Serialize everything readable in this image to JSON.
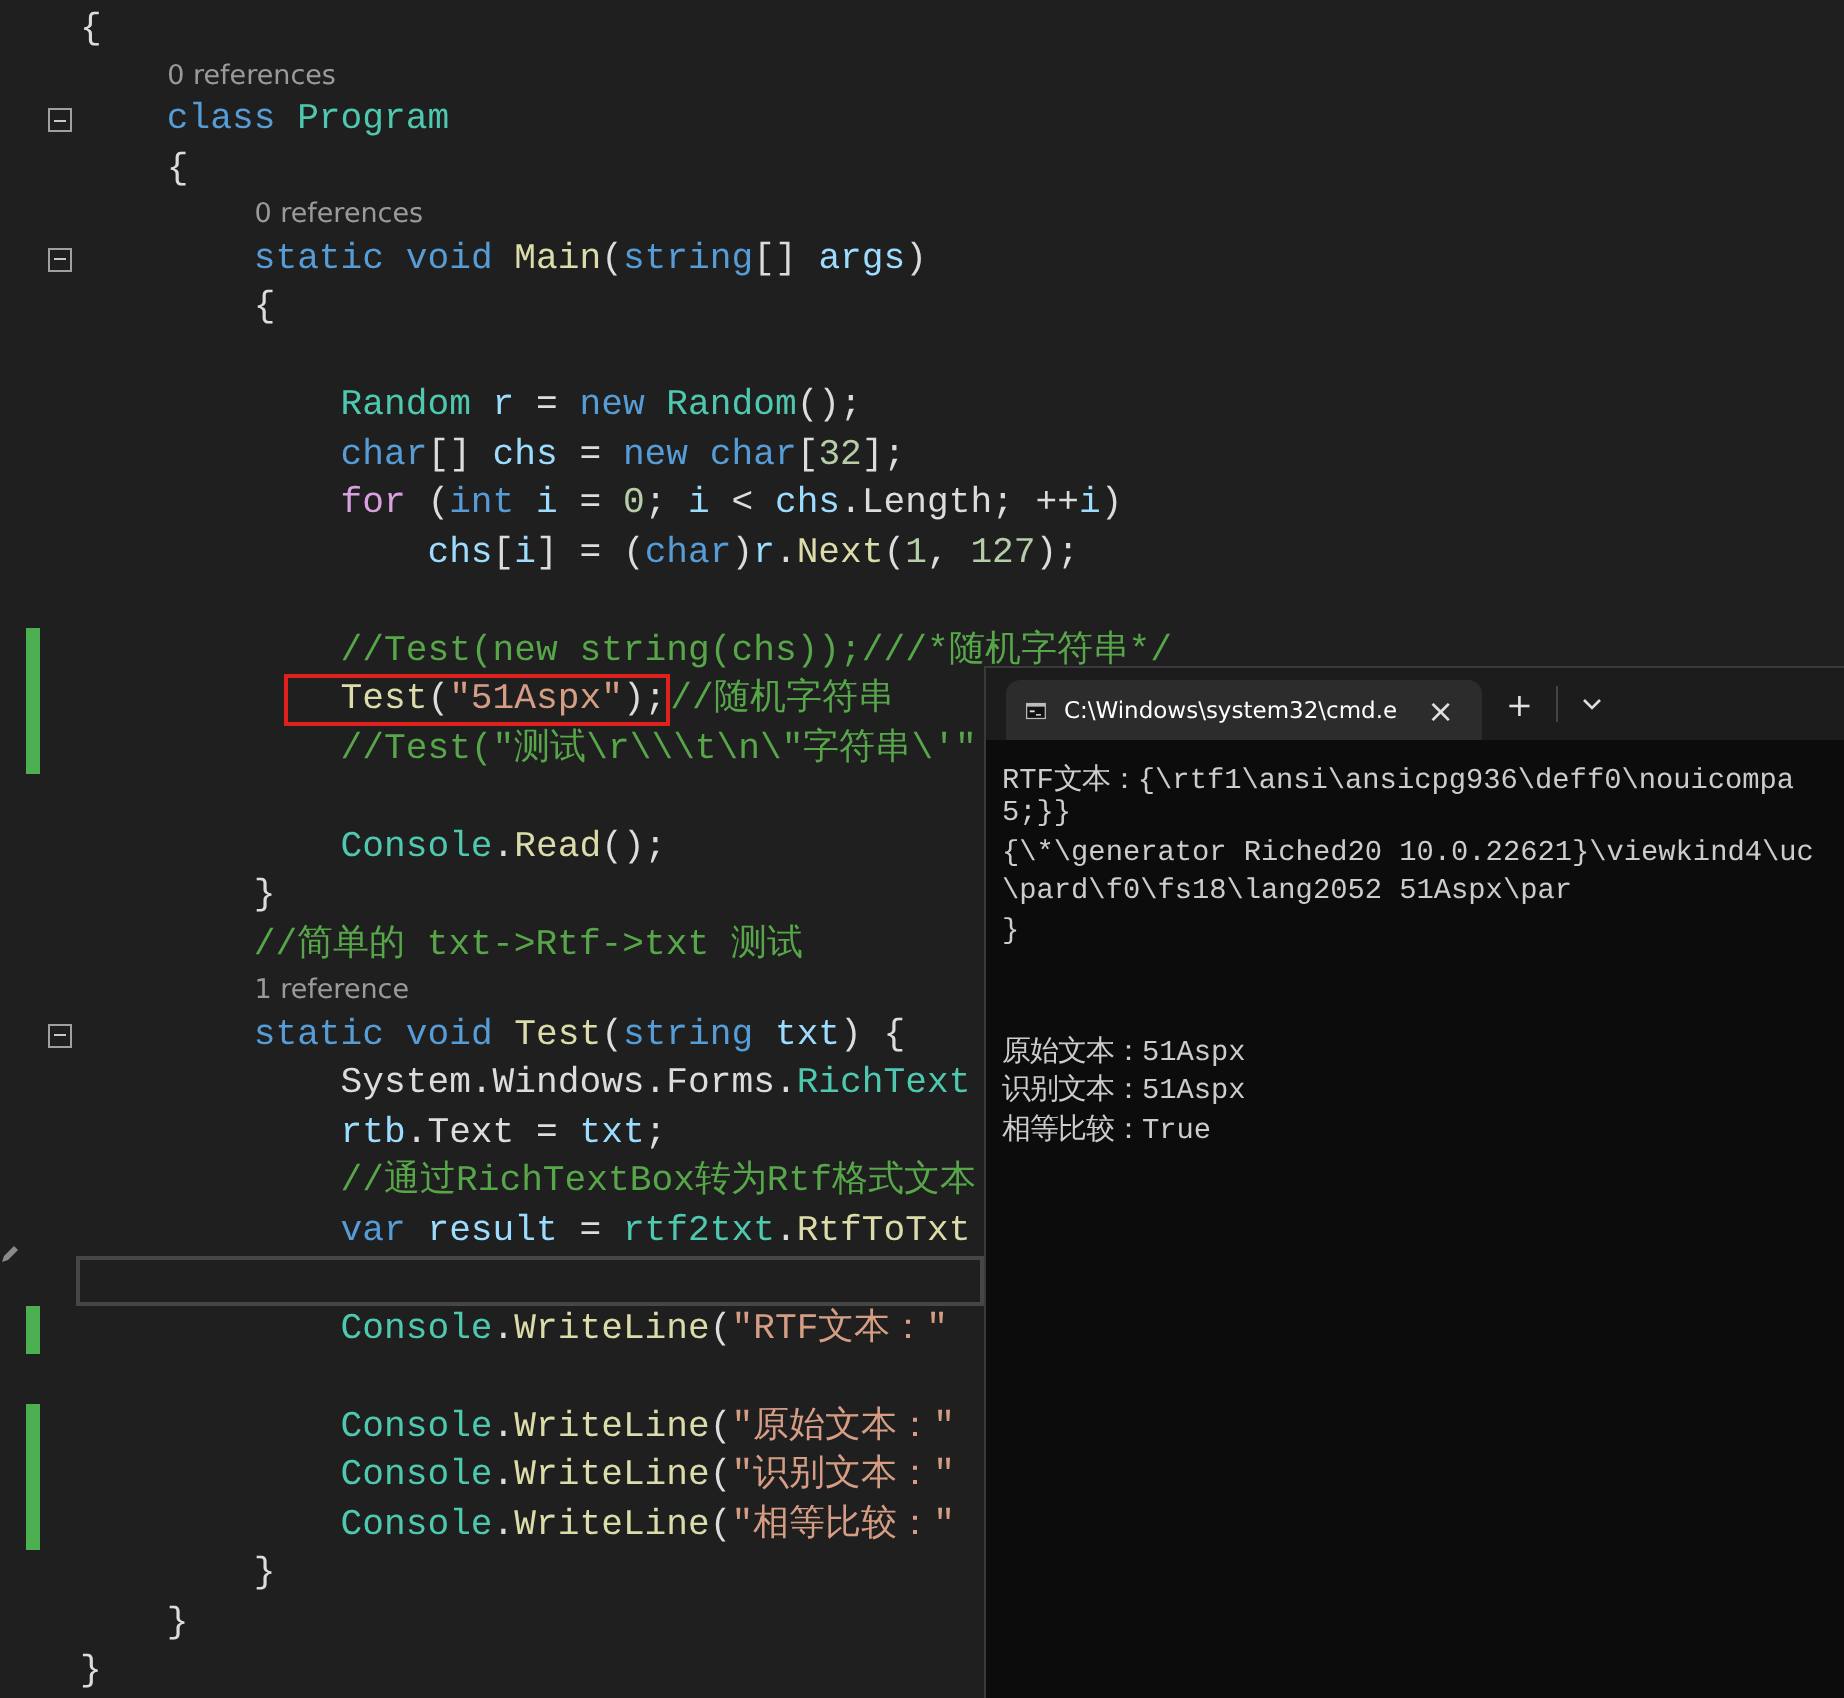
{
  "editor": {
    "lines": [
      {
        "kind": "code",
        "changed": false,
        "tokens": [
          {
            "kind": "plain",
            "t": "{"
          }
        ],
        "children": [
          {
            "kind": "codelens",
            "text": "0 references"
          },
          {
            "kind": "code",
            "changed": false,
            "expanded": true,
            "tokens": [
              {
                "kind": "keyword",
                "t": "class "
              },
              {
                "kind": "type",
                "t": "Program"
              }
            ]
          },
          {
            "kind": "code",
            "changed": false,
            "tokens": [
              {
                "kind": "plain",
                "t": "{"
              }
            ],
            "children": [
              {
                "kind": "codelens",
                "text": "0 references"
              },
              {
                "kind": "code",
                "changed": false,
                "expanded": true,
                "tokens": [
                  {
                    "kind": "keyword",
                    "t": "static void "
                  },
                  {
                    "kind": "method",
                    "t": "Main"
                  },
                  {
                    "kind": "plain",
                    "t": "("
                  },
                  {
                    "kind": "keyword",
                    "t": "string"
                  },
                  {
                    "kind": "plain",
                    "t": "[] "
                  },
                  {
                    "kind": "variable",
                    "t": "args"
                  },
                  {
                    "kind": "plain",
                    "t": ")"
                  }
                ]
              },
              {
                "kind": "code",
                "changed": false,
                "tokens": [
                  {
                    "kind": "plain",
                    "t": "{"
                  }
                ],
                "children": [
                  {
                    "kind": "blank"
                  },
                  {
                    "kind": "code",
                    "changed": false,
                    "tokens": [
                      {
                        "kind": "type",
                        "t": "Random "
                      },
                      {
                        "kind": "variable",
                        "t": "r"
                      },
                      {
                        "kind": "plain",
                        "t": " = "
                      },
                      {
                        "kind": "keyword",
                        "t": "new "
                      },
                      {
                        "kind": "type",
                        "t": "Random"
                      },
                      {
                        "kind": "plain",
                        "t": "();"
                      }
                    ]
                  },
                  {
                    "kind": "code",
                    "changed": false,
                    "tokens": [
                      {
                        "kind": "keyword",
                        "t": "char"
                      },
                      {
                        "kind": "plain",
                        "t": "[] "
                      },
                      {
                        "kind": "variable",
                        "t": "chs"
                      },
                      {
                        "kind": "plain",
                        "t": " = "
                      },
                      {
                        "kind": "keyword",
                        "t": "new char"
                      },
                      {
                        "kind": "plain",
                        "t": "["
                      },
                      {
                        "kind": "number",
                        "t": "32"
                      },
                      {
                        "kind": "plain",
                        "t": "];"
                      }
                    ]
                  },
                  {
                    "kind": "code",
                    "changed": false,
                    "tokens": [
                      {
                        "kind": "control",
                        "t": "for"
                      },
                      {
                        "kind": "plain",
                        "t": " ("
                      },
                      {
                        "kind": "keyword",
                        "t": "int "
                      },
                      {
                        "kind": "variable",
                        "t": "i"
                      },
                      {
                        "kind": "plain",
                        "t": " = "
                      },
                      {
                        "kind": "number",
                        "t": "0"
                      },
                      {
                        "kind": "plain",
                        "t": "; "
                      },
                      {
                        "kind": "variable",
                        "t": "i"
                      },
                      {
                        "kind": "plain",
                        "t": " < "
                      },
                      {
                        "kind": "variable",
                        "t": "chs"
                      },
                      {
                        "kind": "plain",
                        "t": ".Length; ++"
                      },
                      {
                        "kind": "variable",
                        "t": "i"
                      },
                      {
                        "kind": "plain",
                        "t": ")"
                      }
                    ],
                    "children": [
                      {
                        "kind": "code",
                        "changed": false,
                        "tokens": [
                          {
                            "kind": "variable",
                            "t": "chs"
                          },
                          {
                            "kind": "plain",
                            "t": "["
                          },
                          {
                            "kind": "variable",
                            "t": "i"
                          },
                          {
                            "kind": "plain",
                            "t": "] = ("
                          },
                          {
                            "kind": "keyword",
                            "t": "char"
                          },
                          {
                            "kind": "plain",
                            "t": ")"
                          },
                          {
                            "kind": "variable",
                            "t": "r"
                          },
                          {
                            "kind": "plain",
                            "t": "."
                          },
                          {
                            "kind": "method",
                            "t": "Next"
                          },
                          {
                            "kind": "plain",
                            "t": "("
                          },
                          {
                            "kind": "number",
                            "t": "1"
                          },
                          {
                            "kind": "plain",
                            "t": ", "
                          },
                          {
                            "kind": "number",
                            "t": "127"
                          },
                          {
                            "kind": "plain",
                            "t": ");"
                          }
                        ]
                      }
                    ]
                  },
                  {
                    "kind": "blank"
                  },
                  {
                    "kind": "code",
                    "changed": true,
                    "tokens": [
                      {
                        "kind": "comment",
                        "t": "//Test(new string(chs));///*随机字符串*/"
                      }
                    ]
                  },
                  {
                    "kind": "code",
                    "changed": true,
                    "tokens": [
                      {
                        "kind": "method",
                        "t": "Test",
                        "boxed": true
                      },
                      {
                        "kind": "plain",
                        "t": "(",
                        "boxed": true
                      },
                      {
                        "kind": "string",
                        "t": "\"51Aspx\"",
                        "boxed": true
                      },
                      {
                        "kind": "plain",
                        "t": ");",
                        "boxed": true
                      },
                      {
                        "kind": "comment",
                        "t": "//随机字符串"
                      }
                    ]
                  },
                  {
                    "kind": "code",
                    "changed": true,
                    "tokens": [
                      {
                        "kind": "comment",
                        "t": "//Test(\"测试\\r\\\\\\t\\n\\\"字符串\\'\""
                      }
                    ]
                  },
                  {
                    "kind": "blank"
                  },
                  {
                    "kind": "code",
                    "changed": false,
                    "tokens": [
                      {
                        "kind": "type",
                        "t": "Console"
                      },
                      {
                        "kind": "plain",
                        "t": "."
                      },
                      {
                        "kind": "method",
                        "t": "Read"
                      },
                      {
                        "kind": "plain",
                        "t": "();"
                      }
                    ]
                  }
                ]
              },
              {
                "kind": "code",
                "changed": false,
                "tokens": [
                  {
                    "kind": "plain",
                    "t": "}"
                  }
                ]
              },
              {
                "kind": "code",
                "changed": false,
                "tokens": [
                  {
                    "kind": "comment",
                    "t": "//简单的 txt->Rtf->txt 测试"
                  }
                ]
              },
              {
                "kind": "codelens",
                "text": "1 reference"
              },
              {
                "kind": "code",
                "changed": false,
                "expanded": true,
                "tokens": [
                  {
                    "kind": "keyword",
                    "t": "static void "
                  },
                  {
                    "kind": "method",
                    "t": "Test"
                  },
                  {
                    "kind": "plain",
                    "t": "("
                  },
                  {
                    "kind": "keyword",
                    "t": "string "
                  },
                  {
                    "kind": "variable",
                    "t": "txt"
                  },
                  {
                    "kind": "plain",
                    "t": ") {"
                  }
                ],
                "children": [
                  {
                    "kind": "code",
                    "changed": false,
                    "tokens": [
                      {
                        "kind": "plain",
                        "t": "System.Windows.Forms."
                      },
                      {
                        "kind": "type",
                        "t": "RichText"
                      }
                    ]
                  },
                  {
                    "kind": "code",
                    "changed": false,
                    "tokens": [
                      {
                        "kind": "variable",
                        "t": "rtb"
                      },
                      {
                        "kind": "plain",
                        "t": ".Text = "
                      },
                      {
                        "kind": "variable",
                        "t": "txt"
                      },
                      {
                        "kind": "plain",
                        "t": ";"
                      }
                    ]
                  },
                  {
                    "kind": "code",
                    "changed": false,
                    "tokens": [
                      {
                        "kind": "comment",
                        "t": "//通过RichTextBox转为Rtf格式文本"
                      }
                    ]
                  },
                  {
                    "kind": "code",
                    "changed": false,
                    "tokens": [
                      {
                        "kind": "keyword",
                        "t": "var "
                      },
                      {
                        "kind": "variable",
                        "t": "result"
                      },
                      {
                        "kind": "plain",
                        "t": " = "
                      },
                      {
                        "kind": "type",
                        "t": "rtf2txt"
                      },
                      {
                        "kind": "plain",
                        "t": "."
                      },
                      {
                        "kind": "method",
                        "t": "RtfToTxt"
                      }
                    ]
                  },
                  {
                    "kind": "blank",
                    "current": true
                  },
                  {
                    "kind": "code",
                    "changed": true,
                    "tokens": [
                      {
                        "kind": "type",
                        "t": "Console"
                      },
                      {
                        "kind": "plain",
                        "t": "."
                      },
                      {
                        "kind": "method",
                        "t": "WriteLine"
                      },
                      {
                        "kind": "plain",
                        "t": "("
                      },
                      {
                        "kind": "string",
                        "t": "\"RTF文本：\""
                      }
                    ]
                  },
                  {
                    "kind": "blank"
                  },
                  {
                    "kind": "code",
                    "changed": true,
                    "tokens": [
                      {
                        "kind": "type",
                        "t": "Console"
                      },
                      {
                        "kind": "plain",
                        "t": "."
                      },
                      {
                        "kind": "method",
                        "t": "WriteLine"
                      },
                      {
                        "kind": "plain",
                        "t": "("
                      },
                      {
                        "kind": "string",
                        "t": "\"原始文本：\""
                      }
                    ]
                  },
                  {
                    "kind": "code",
                    "changed": true,
                    "tokens": [
                      {
                        "kind": "type",
                        "t": "Console"
                      },
                      {
                        "kind": "plain",
                        "t": "."
                      },
                      {
                        "kind": "method",
                        "t": "WriteLine"
                      },
                      {
                        "kind": "plain",
                        "t": "("
                      },
                      {
                        "kind": "string",
                        "t": "\"识别文本：\""
                      }
                    ]
                  },
                  {
                    "kind": "code",
                    "changed": true,
                    "tokens": [
                      {
                        "kind": "type",
                        "t": "Console"
                      },
                      {
                        "kind": "plain",
                        "t": "."
                      },
                      {
                        "kind": "method",
                        "t": "WriteLine"
                      },
                      {
                        "kind": "plain",
                        "t": "("
                      },
                      {
                        "kind": "string",
                        "t": "\"相等比较：\""
                      }
                    ]
                  }
                ]
              },
              {
                "kind": "code",
                "changed": false,
                "tokens": [
                  {
                    "kind": "plain",
                    "t": "}"
                  }
                ]
              }
            ]
          },
          {
            "kind": "code",
            "changed": false,
            "tokens": [
              {
                "kind": "plain",
                "t": "}"
              }
            ]
          }
        ]
      },
      {
        "kind": "code",
        "changed": false,
        "tokens": [
          {
            "kind": "plain",
            "t": "}"
          }
        ]
      }
    ]
  },
  "terminal": {
    "tab_title": "C:\\Windows\\system32\\cmd.e",
    "close": "×",
    "new_tab": "+",
    "output": [
      "RTF文本：{\\rtf1\\ansi\\ansicpg936\\deff0\\nouicompa",
      "5;}}",
      "{\\*\\generator Riched20 10.0.22621}\\viewkind4\\uc",
      "\\pard\\f0\\fs18\\lang2052 51Aspx\\par",
      "}",
      {
        "kind": "blank"
      },
      {
        "kind": "blank"
      },
      "原始文本：51Aspx",
      "识别文本：51Aspx",
      "相等比较：True"
    ]
  }
}
